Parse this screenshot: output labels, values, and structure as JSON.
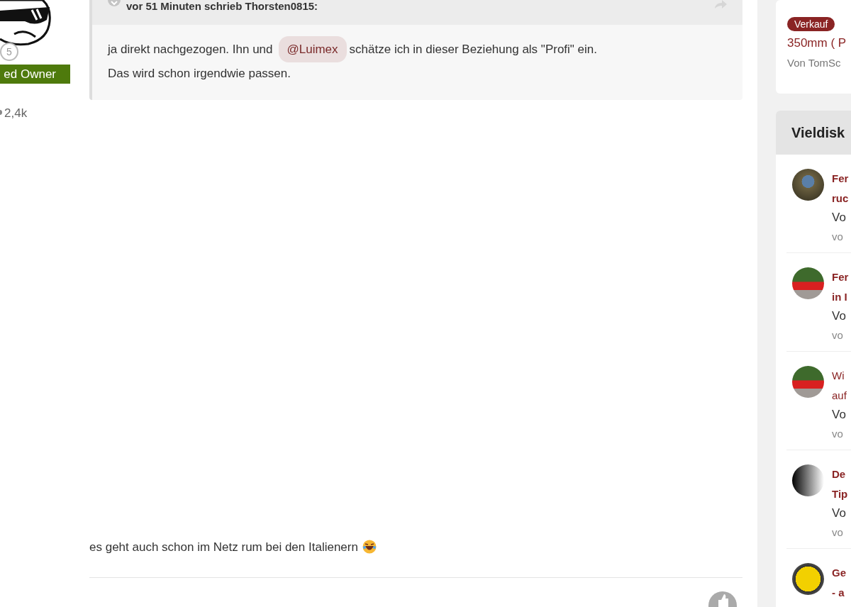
{
  "author": {
    "rank_number": "5",
    "group_label": "ed Owner",
    "reputation": "2,4k"
  },
  "post": {
    "quote": {
      "header": "vor 51 Minuten schrieb Thorsten0815:",
      "lines": [
        {
          "before": "ja direkt nachgezogen. Ihn und",
          "mention": "@Luimex",
          "after": "schätze ich in dieser Beziehung als \"Profi\" ein."
        },
        {
          "before": "Das wird schon irgendwie passen."
        }
      ]
    },
    "text": "es geht auch schon im Netz rum bei den Italienern"
  },
  "sidebar": {
    "top_item": {
      "tag": "Verkauf",
      "title": "350mm ( P",
      "byline": "Von TomSc"
    },
    "widget_title": "Vieldisk",
    "threads": [
      {
        "kind": "painting",
        "title_lines": [
          "Fer",
          "ruc"
        ],
        "unread": true,
        "author": "Vo",
        "time": "vo"
      },
      {
        "kind": "red-car",
        "title_lines": [
          "Fer",
          "in I"
        ],
        "unread": true,
        "author": "Vo",
        "time": "vo"
      },
      {
        "kind": "red-car",
        "title_lines": [
          "Wi",
          "auf"
        ],
        "unread": false,
        "author": "Vo",
        "time": "vo"
      },
      {
        "kind": "logo",
        "title_lines": [
          "De",
          "Tip"
        ],
        "unread": true,
        "author": "Vo",
        "time": "vo"
      },
      {
        "kind": "yellow-car",
        "title_lines": [
          "Ge",
          "- a"
        ],
        "unread": true
      }
    ]
  }
}
